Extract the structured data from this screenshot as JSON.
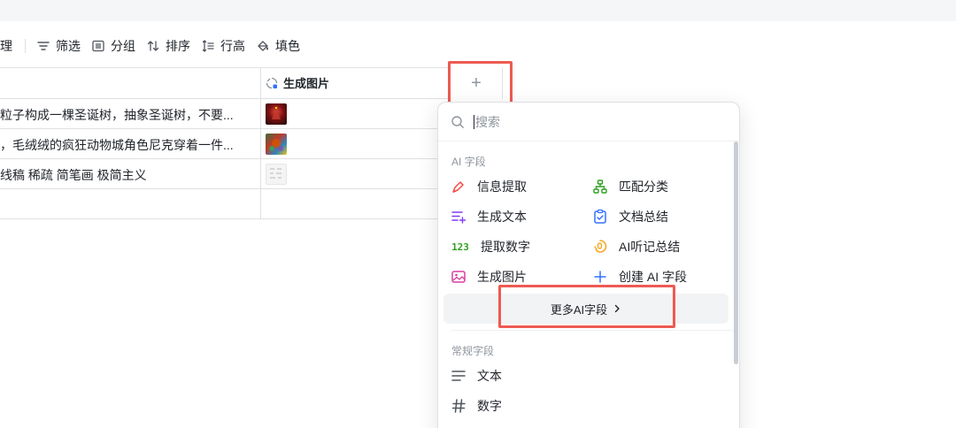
{
  "toolbar": {
    "items": [
      {
        "label": "理"
      },
      {
        "label": "筛选"
      },
      {
        "label": "分组"
      },
      {
        "label": "排序"
      },
      {
        "label": "行高"
      },
      {
        "label": "填色"
      }
    ]
  },
  "table": {
    "column_header": "生成图片",
    "add_column_label": "+",
    "rows": [
      {
        "text": "粒子构成一棵圣诞树，抽象圣诞树，不要..."
      },
      {
        "text": "，毛绒绒的疯狂动物城角色尼克穿着一件..."
      },
      {
        "text": " 线稿 稀疏 简笔画 极简主义"
      }
    ]
  },
  "dropdown": {
    "search_placeholder": "搜索",
    "ai_section_title": "AI 字段",
    "ai_items": [
      {
        "label": "信息提取",
        "icon": "pen-icon",
        "color": "#f54a45"
      },
      {
        "label": "匹配分类",
        "icon": "tree-icon",
        "color": "#2ea121"
      },
      {
        "label": "生成文本",
        "icon": "text-sparkle-icon",
        "color": "#7f3bf5"
      },
      {
        "label": "文档总结",
        "icon": "clipboard-icon",
        "color": "#3370ff"
      },
      {
        "label": "提取数字",
        "icon": "number-icon",
        "color": "#2ea121"
      },
      {
        "label": "AI听记总结",
        "icon": "mic-icon",
        "color": "#f5a623"
      },
      {
        "label": "生成图片",
        "icon": "image-icon",
        "color": "#d83f9e"
      },
      {
        "label": "创建 AI 字段",
        "icon": "plus-icon",
        "color": "#3370ff"
      }
    ],
    "more_ai_label": "更多AI字段",
    "regular_section_title": "常规字段",
    "regular_items": [
      {
        "label": "文本",
        "icon": "lines-icon"
      },
      {
        "label": "数字",
        "icon": "hash-icon"
      }
    ]
  },
  "colors": {
    "highlight": "#ee5a52",
    "accent": "#3370ff"
  }
}
